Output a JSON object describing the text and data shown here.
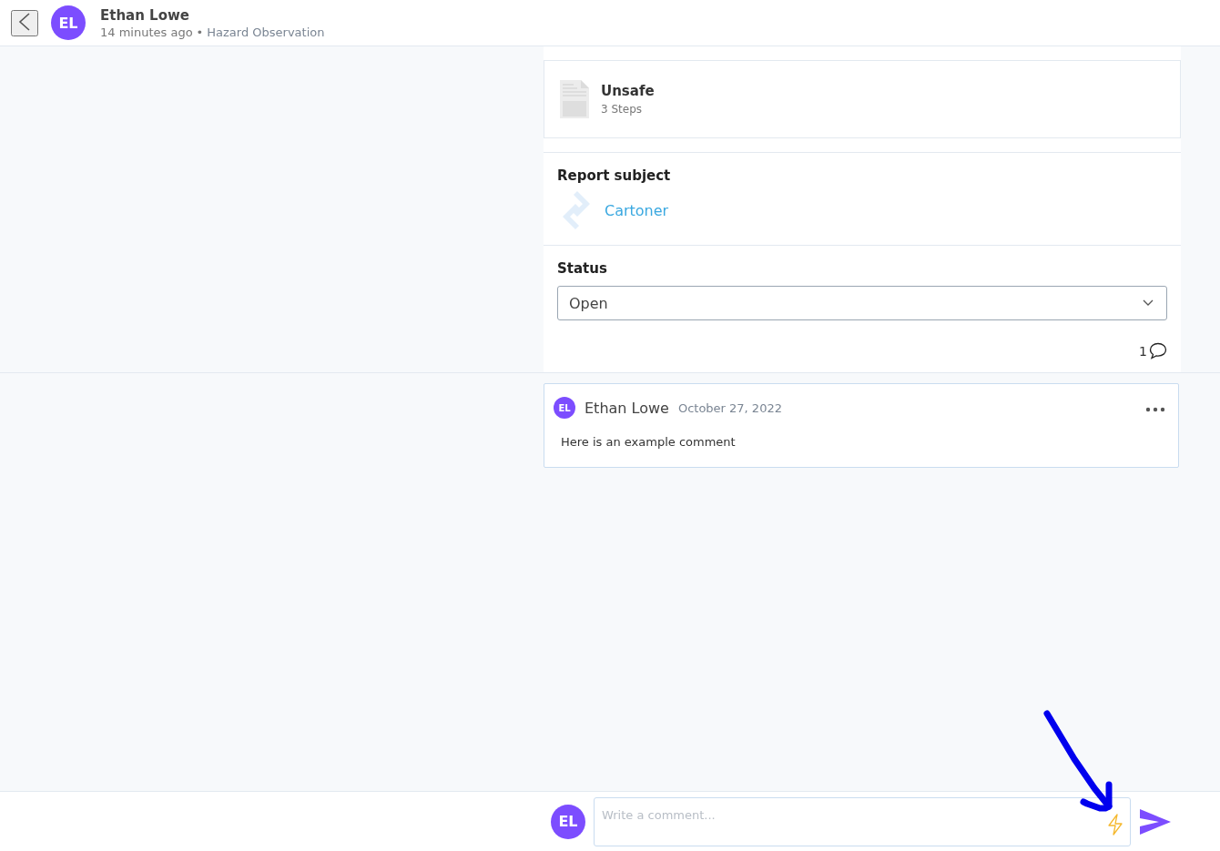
{
  "header": {
    "avatar_initials": "EL",
    "author": "Ethan Lowe",
    "time": "14 minutes ago",
    "separator": "•",
    "category": "Hazard Observation"
  },
  "checklist": {
    "title": "Unsafe",
    "steps": "3 Steps"
  },
  "report_subject": {
    "label": "Report subject",
    "value": "Cartoner"
  },
  "status": {
    "label": "Status",
    "value": "Open"
  },
  "comment_count": "1",
  "comments": [
    {
      "avatar_initials": "EL",
      "author": "Ethan Lowe",
      "date": "October 27, 2022",
      "text": "Here is an example comment"
    }
  ],
  "composer": {
    "avatar_initials": "EL",
    "placeholder": "Write a comment..."
  }
}
